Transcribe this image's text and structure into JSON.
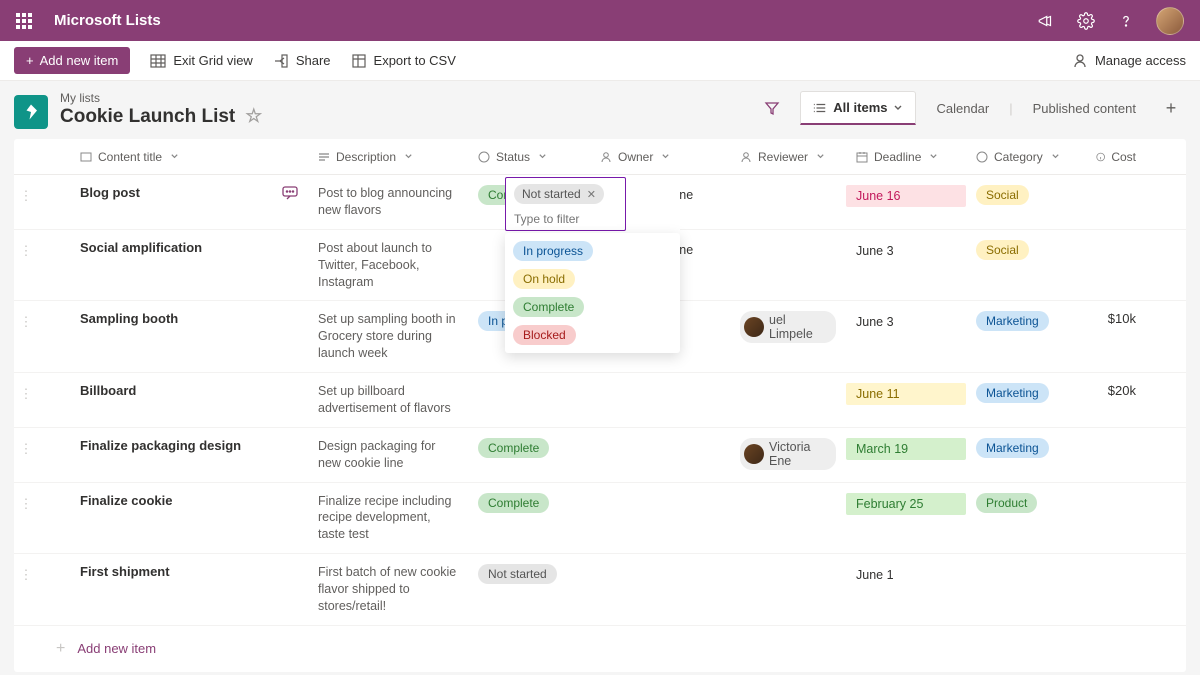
{
  "header": {
    "app_name": "Microsoft Lists"
  },
  "commandbar": {
    "add_new_item": "Add new item",
    "exit_grid": "Exit Grid view",
    "share": "Share",
    "export": "Export to CSV",
    "manage_access": "Manage access"
  },
  "list_header": {
    "breadcrumb": "My lists",
    "title": "Cookie Launch List",
    "views": {
      "active": "All items",
      "calendar": "Calendar",
      "published": "Published content"
    }
  },
  "columns": {
    "title": "Content title",
    "description": "Description",
    "status": "Status",
    "owner": "Owner",
    "reviewer": "Reviewer",
    "deadline": "Deadline",
    "category": "Category",
    "cost": "Cost"
  },
  "status_filter": {
    "selected_chip": "Not started",
    "placeholder": "Type to filter",
    "options": {
      "in_progress": "In progress",
      "on_hold": "On hold",
      "complete": "Complete",
      "blocked": "Blocked"
    }
  },
  "rows": [
    {
      "title": "Blog post",
      "has_comments": true,
      "description": "Post to blog announcing new flavors",
      "status": "Complete",
      "status_class": "pill-green",
      "owner": "Victoria Ene",
      "owner_pilled": false,
      "reviewer": "",
      "deadline": "June 16",
      "deadline_class": "dl-pink",
      "category": "Social",
      "category_class": "pill-yellow",
      "cost": ""
    },
    {
      "title": "Social amplification",
      "description": "Post about launch to Twitter, Facebook, Instagram",
      "status": "",
      "owner": "Victoria Ene",
      "owner_pilled": false,
      "reviewer": "",
      "deadline": "June 3",
      "deadline_class": "",
      "category": "Social",
      "category_class": "pill-yellow",
      "cost": ""
    },
    {
      "title": "Sampling booth",
      "description": "Set up sampling booth in Grocery store during launch week",
      "status": "In progress",
      "status_class": "pill-blue",
      "owner": "",
      "reviewer": "uel Limpele",
      "reviewer_pilled": true,
      "deadline": "June 3",
      "deadline_class": "",
      "category": "Marketing",
      "category_class": "pill-blue",
      "cost": "$10k"
    },
    {
      "title": "Billboard",
      "description": "Set up billboard advertisement of flavors",
      "status": "",
      "owner": "",
      "reviewer": "",
      "deadline": "June 11",
      "deadline_class": "dl-yellow",
      "category": "Marketing",
      "category_class": "pill-blue",
      "cost": "$20k"
    },
    {
      "title": "Finalize packaging design",
      "description": "Design packaging for new cookie line",
      "status": "Complete",
      "status_class": "pill-green",
      "owner": "",
      "reviewer": "Victoria Ene",
      "reviewer_pilled": true,
      "deadline": "March 19",
      "deadline_class": "dl-green",
      "category": "Marketing",
      "category_class": "pill-blue",
      "cost": ""
    },
    {
      "title": "Finalize cookie",
      "description": "Finalize recipe including recipe development, taste test",
      "status": "Complete",
      "status_class": "pill-green",
      "owner": "",
      "reviewer": "",
      "deadline": "February 25",
      "deadline_class": "dl-green",
      "category": "Product",
      "category_class": "pill-prodgreen",
      "cost": ""
    },
    {
      "title": "First shipment",
      "description": "First batch of new cookie flavor shipped to stores/retail!",
      "status": "Not started",
      "status_class": "pill-grey",
      "owner": "",
      "reviewer": "",
      "deadline": "June 1",
      "deadline_class": "",
      "category": "",
      "category_class": "",
      "cost": ""
    }
  ],
  "footer": {
    "add_new_item": "Add new item"
  }
}
